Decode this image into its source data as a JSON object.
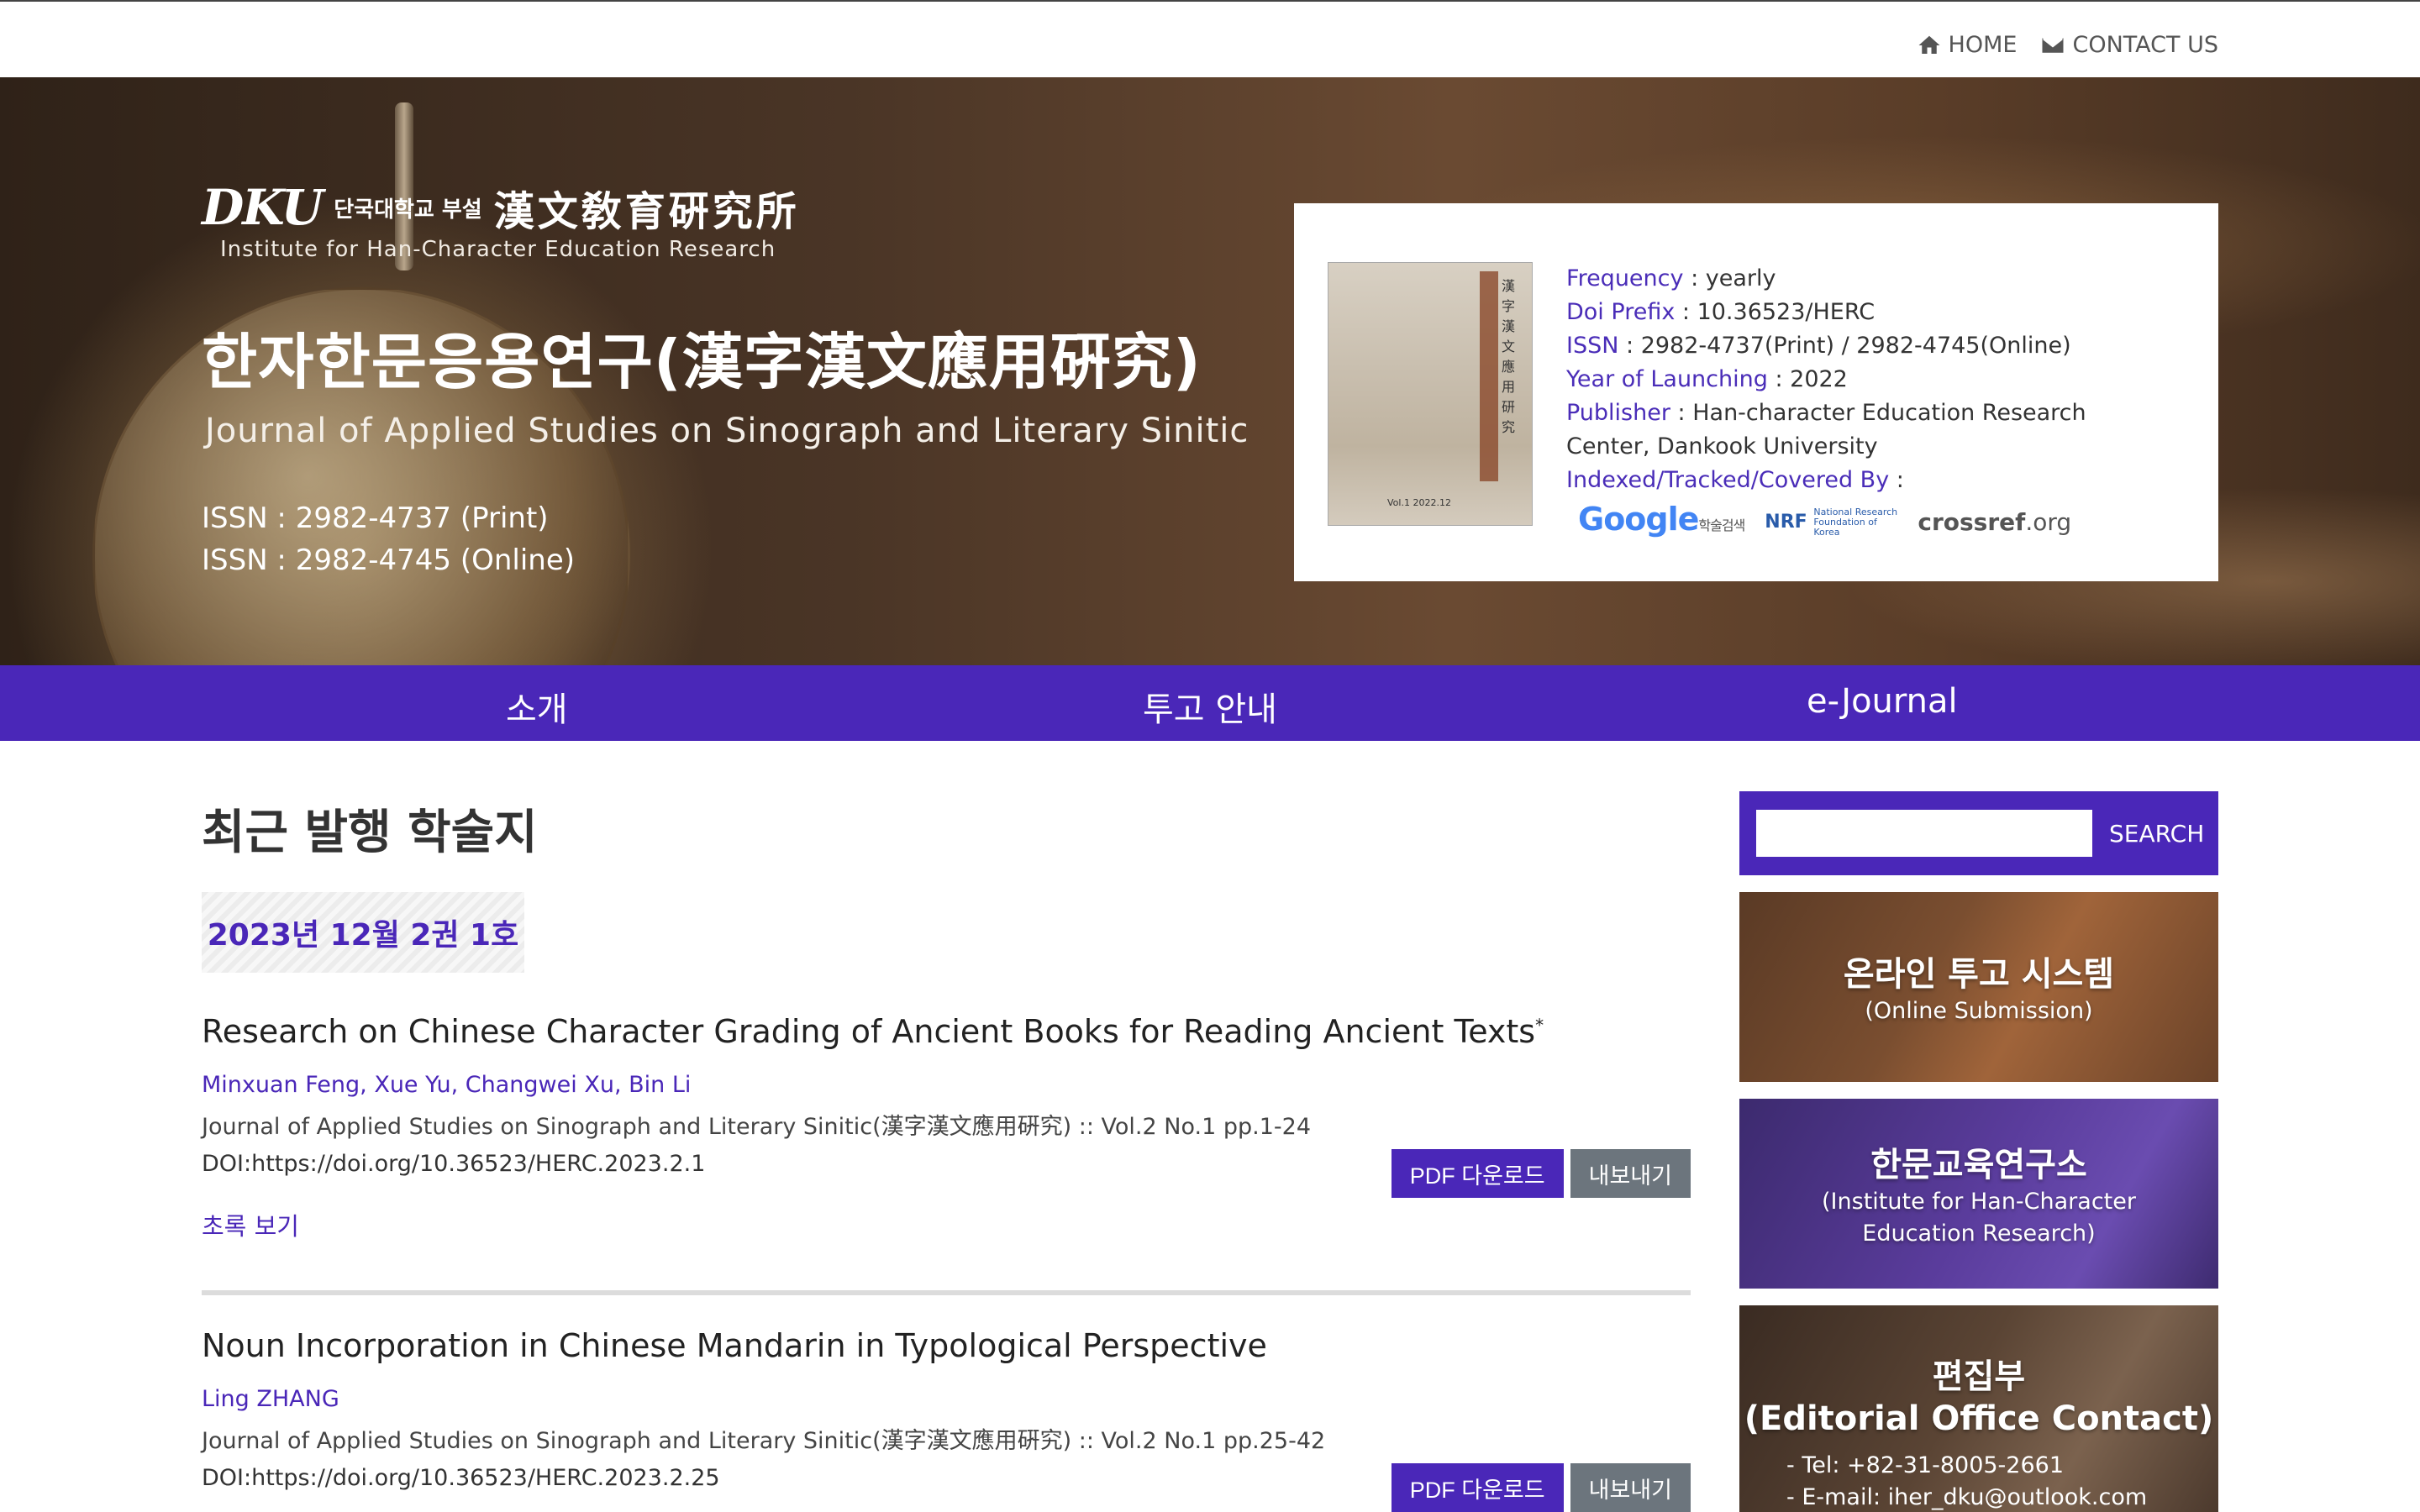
{
  "topnav": {
    "home": "HOME",
    "contact": "CONTACT US"
  },
  "hero": {
    "logo_mark": "DKU",
    "logo_ko": "단국대학교 부설",
    "logo_hanja": "漢文敎育硏究所",
    "logo_en": "Institute for Han-Character  Education  Research",
    "title": "한자한문응용연구(漢字漢文應用硏究)",
    "subtitle": "Journal of Applied Studies on Sinograph and Literary Sinitic",
    "issn_print": "ISSN : 2982-4737 (Print)",
    "issn_online": "ISSN : 2982-4745 (Online)"
  },
  "info": {
    "cover_text": "漢字漢文應用研究",
    "cover_foot": "Vol.1 2022.12",
    "frequency_label": "Frequency",
    "frequency_value": " : yearly",
    "doi_label": "Doi Prefix",
    "doi_value": " : 10.36523/HERC",
    "issn_label": "ISSN",
    "issn_value": " : 2982-4737(Print) / 2982-4745(Online)",
    "year_label": "Year of Launching",
    "year_value": " : 2022",
    "publisher_label": "Publisher",
    "publisher_value": " : Han-character Education Research Center, Dankook University",
    "indexed_label": "Indexed/Tracked/Covered By",
    "indexed_value": " :",
    "logo_google": "Google",
    "logo_google_small": "학술검색",
    "logo_nrf": "NRF",
    "logo_nrf_small": "National Research Foundation of Korea",
    "logo_crossref": "crossref",
    "logo_crossref_tld": ".org"
  },
  "mainnav": {
    "items": [
      "소개",
      "투고 안내",
      "e-Journal"
    ]
  },
  "content": {
    "section_title": "최근 발행 학술지",
    "issue": "2023년 12월  2권 1호",
    "articles": [
      {
        "title": "Research on Chinese Character Grading of Ancient Books for Reading Ancient Texts",
        "mark": "*",
        "authors": "Minxuan Feng, Xue Yu, Changwei Xu, Bin Li",
        "journal": "Journal of Applied Studies on Sinograph and Literary Sinitic(漢字漢文應用硏究) :: Vol.2 No.1 pp.1-24",
        "doi": "DOI:https://doi.org/10.36523/HERC.2023.2.1",
        "abstract": "초록 보기",
        "pdf": "PDF 다운로드",
        "export": "내보내기"
      },
      {
        "title": "Noun Incorporation in Chinese Mandarin in Typological Perspective",
        "authors": "Ling ZHANG",
        "journal": "Journal of Applied Studies on Sinograph and Literary Sinitic(漢字漢文應用硏究) :: Vol.2 No.1 pp.25-42",
        "doi": "DOI:https://doi.org/10.36523/HERC.2023.2.25",
        "pdf": "PDF 다운로드",
        "export": "내보내기"
      }
    ]
  },
  "sidebar": {
    "search_button": "SEARCH",
    "search_value": "",
    "online": {
      "title": "온라인 투고 시스템",
      "sub": "(Online Submission)"
    },
    "institute": {
      "title": "한문교육연구소",
      "sub1": "(Institute for Han-Character",
      "sub2": "Education Research)"
    },
    "editorial": {
      "title": "편집부",
      "title2": "(Editorial Office Contact)",
      "tel": "- Tel: +82-31-8005-2661",
      "email": "- E-mail: iher_dku@outlook.com"
    }
  },
  "colors": {
    "brand": "#4a27b8",
    "export_button": "#6c757d"
  }
}
